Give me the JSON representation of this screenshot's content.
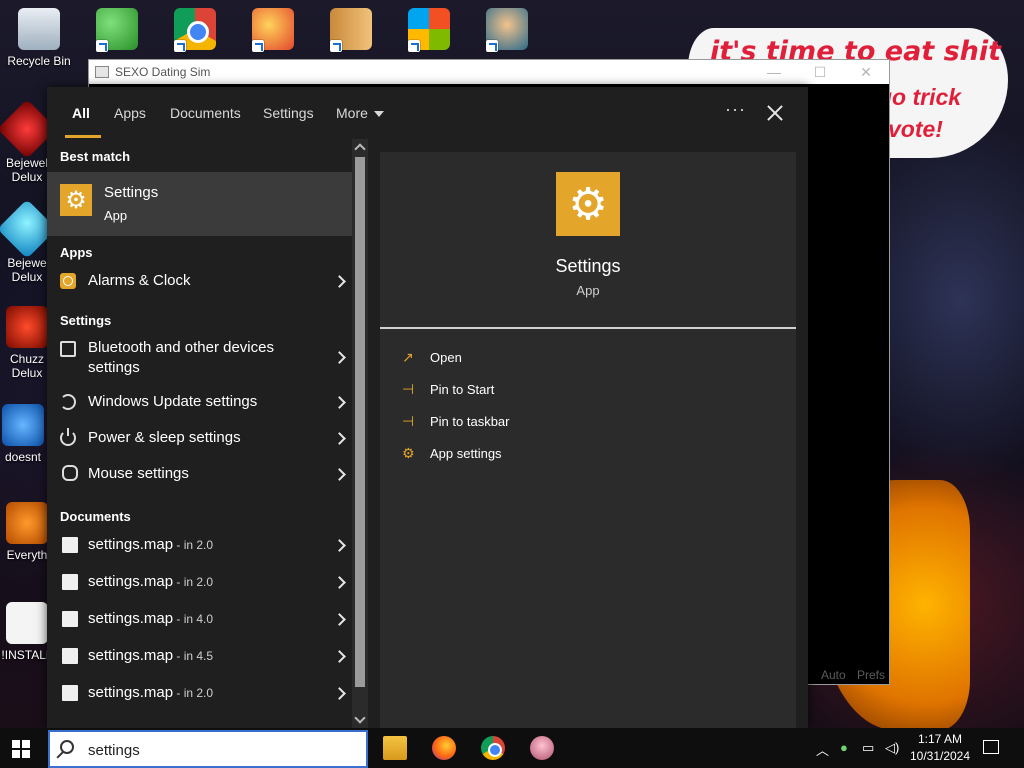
{
  "desktop": {
    "icons": [
      {
        "label": "Recycle Bin"
      },
      {
        "label": "Bejewel Delux"
      },
      {
        "label": "Bejewe Delux"
      },
      {
        "label": "Chuzz Delux"
      },
      {
        "label": "doesnt"
      },
      {
        "label": "Everyth"
      },
      {
        "label": "!INSTALL"
      }
    ],
    "bubble": {
      "line1": "it's time to eat shit",
      "line2": "go trick",
      "line3": "vote!"
    }
  },
  "background_window": {
    "title": "SEXO Dating Sim",
    "footer": [
      "Auto",
      "Prefs"
    ]
  },
  "search_panel": {
    "tabs": [
      "All",
      "Apps",
      "Documents",
      "Settings",
      "More"
    ],
    "active_tab": "All",
    "more_options": "···",
    "best_match": {
      "section": "Best match",
      "title": "Settings",
      "subtitle": "App"
    },
    "apps_section": "Apps",
    "apps": [
      {
        "label": "Alarms & Clock",
        "icon": "alarm-clock-icon"
      }
    ],
    "settings_section": "Settings",
    "settings": [
      {
        "line1": "Bluetooth and other devices",
        "line2": "settings",
        "icon": "devices-icon"
      },
      {
        "label": "Windows Update settings",
        "icon": "update-icon"
      },
      {
        "label": "Power & sleep settings",
        "icon": "power-icon"
      },
      {
        "label": "Mouse settings",
        "icon": "mouse-icon"
      }
    ],
    "documents_section": "Documents",
    "documents": [
      {
        "name": "settings.map",
        "loc": " - in 2.0"
      },
      {
        "name": "settings.map",
        "loc": " - in 2.0"
      },
      {
        "name": "settings.map",
        "loc": " - in 4.0"
      },
      {
        "name": "settings.map",
        "loc": " - in 4.5"
      },
      {
        "name": "settings.map",
        "loc": " - in 2.0"
      }
    ],
    "detail": {
      "title": "Settings",
      "subtitle": "App",
      "actions": [
        {
          "label": "Open",
          "icon": "open-icon"
        },
        {
          "label": "Pin to Start",
          "icon": "pin-icon"
        },
        {
          "label": "Pin to taskbar",
          "icon": "pin-icon"
        },
        {
          "label": "App settings",
          "icon": "gear-icon"
        }
      ]
    },
    "accent_color": "#e3a52a"
  },
  "taskbar": {
    "search_value": "settings",
    "clock_time": "1:17 AM",
    "clock_date": "10/31/2024"
  }
}
